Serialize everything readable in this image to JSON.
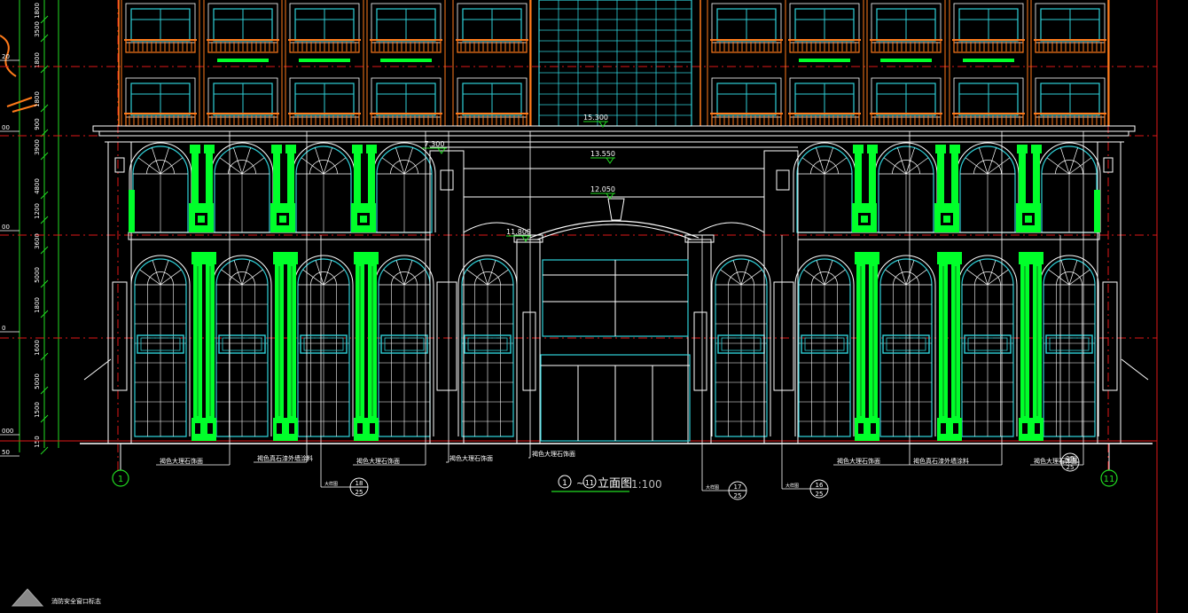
{
  "colors": {
    "background": "#000000",
    "wall": "#ffffff",
    "glass": "#2fd0d8",
    "column": "#00ff2a",
    "balcony": "#ff7a1a",
    "dimension": "#e01818",
    "level_mark": "#22dd22"
  },
  "elevations": [
    "15.300",
    "13.550",
    "12.050",
    "11.800",
    "7.300"
  ],
  "title": {
    "axis_start": "1",
    "axis_end": "11",
    "text": "立面图",
    "scale": "1:100"
  },
  "axis_labels": [
    "1",
    "11"
  ],
  "callouts": [
    {
      "text": "褐色大理石饰面"
    },
    {
      "text": "褐色真石漆外墙涂料"
    },
    {
      "text": "褐色大理石饰面"
    },
    {
      "text": "褐色大理石饰面"
    },
    {
      "text": "褐色大理石饰面"
    },
    {
      "text": "褐色大理石饰面"
    },
    {
      "text": "褐色真石漆外墙涂料"
    },
    {
      "text": "褐色大理石饰面"
    }
  ],
  "detail_refs": [
    {
      "num": "18",
      "sheet": "25",
      "label": "大样图"
    },
    {
      "num": "17",
      "sheet": "25",
      "label": "大样图"
    },
    {
      "num": "16",
      "sheet": "25",
      "label": "大样图"
    },
    {
      "num": "19",
      "sheet": "25",
      "label": "大样图"
    }
  ],
  "left_dims": [
    "1800",
    "3500",
    "1800",
    "1800",
    "900",
    "3900",
    "4800",
    "1200",
    "3600",
    "5000",
    "1800",
    "1600",
    "5000",
    "1500",
    "150"
  ],
  "left_levels": [
    "20",
    "00",
    "00",
    "0",
    "000",
    "50"
  ],
  "footer_note": "消防安全窗口标志"
}
